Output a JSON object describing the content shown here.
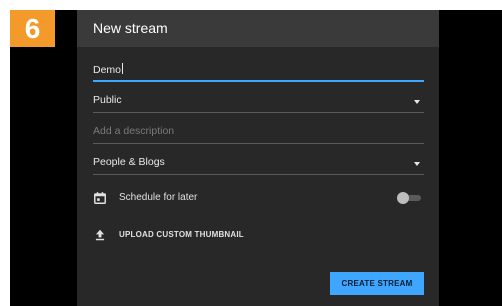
{
  "step": {
    "number": "6"
  },
  "dialog": {
    "title": "New stream",
    "title_field": {
      "value": "Demo"
    },
    "visibility": {
      "selected": "Public"
    },
    "description": {
      "value": "",
      "placeholder": "Add a description"
    },
    "category": {
      "selected": "People & Blogs"
    },
    "schedule": {
      "label": "Schedule for later",
      "toggle_on": false
    },
    "thumbnail": {
      "label": "UPLOAD CUSTOM THUMBNAIL"
    },
    "create_button": {
      "label": "CREATE STREAM"
    }
  },
  "colors": {
    "step_badge": "#f39a2a",
    "accent": "#3ea6ff",
    "dialog_bg": "#282828",
    "header_bg": "#3a3a3a"
  },
  "icons": {
    "schedule": "calendar-icon",
    "thumbnail": "upload-icon",
    "dropdown": "dropdown-arrow-icon"
  }
}
